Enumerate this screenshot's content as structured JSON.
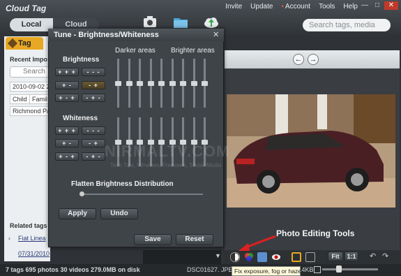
{
  "app": {
    "title": "Cloud Tag"
  },
  "menu": [
    "Invite",
    "Update",
    "Account",
    "Tools",
    "Help"
  ],
  "window_controls": [
    "—",
    "□",
    "✕"
  ],
  "tabs": {
    "local": "Local",
    "cloud": "Cloud"
  },
  "search": {
    "placeholder": "Search tags, media"
  },
  "left_panel": {
    "tag_tab": "Tag",
    "recent_header": "Recent Impo",
    "search_placeholder": "Search",
    "chips": [
      "2010-09-02 2",
      "Child",
      "Famil",
      "Richmond Pa"
    ],
    "related_header": "Related tags",
    "related_items": [
      "Fiat Linea",
      "07/31/2010"
    ]
  },
  "dialog": {
    "title": "Tune - Brightness/Whiteness",
    "close": "✕",
    "brightness_label": "Brightness",
    "whiteness_label": "Whiteness",
    "darker_label": "Darker areas",
    "brighter_label": "Brighter areas",
    "brightness_buttons": [
      "+ + +",
      "- - -",
      "+ -",
      "- +",
      "+ - +",
      "- + -"
    ],
    "whiteness_buttons": [
      "+ + +",
      "- - -",
      "+ -",
      "- +",
      "+ - +",
      "- + -"
    ],
    "flatten_label": "Flatten Brightness Distribution",
    "apply": "Apply",
    "undo": "Undo",
    "save": "Save",
    "reset": "Reset",
    "brightness_slider_levels": [
      0.5,
      0.5,
      0.5,
      0.5,
      0.5,
      0.5,
      0.5,
      0.5,
      0.5
    ],
    "whiteness_slider_levels": [
      0.5,
      0.5,
      0.5,
      0.5,
      0.5,
      0.5,
      0.5,
      0.5,
      0.5
    ],
    "flatten_level": 0
  },
  "watermark": {
    "main": "NIRMALTV.COM",
    "sub": "Tech Tips, Windows, Freeware, Social Media"
  },
  "annotation": "Photo Editing Tools",
  "viewer": {
    "prev": "←",
    "next": "→",
    "fit": "Fit",
    "one_to_one": "1:1"
  },
  "tooltip": "Fix exposure, fog or haze",
  "status": {
    "summary": "7 tags 695 photos 30 videos 279.0MB on disk",
    "filename": "DSC01627. JPEG",
    "filesize": ".4KB"
  },
  "colors": {
    "accent": "#e8a823",
    "dialog_bg": "#3f4448",
    "annotation_arrow": "#e02020"
  }
}
